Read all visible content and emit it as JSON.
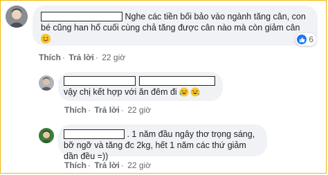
{
  "comments": [
    {
      "text": "Nghe các tiền bối bảo vào ngành tăng cân, con bé cũng han hố cuối cùng chả tăng được cân nào mà còn giảm cân",
      "emoji": "slightly-smiling-face",
      "reaction_count": "6",
      "actions": {
        "like": "Thích",
        "reply": "Trả lời",
        "time": "22 giờ"
      }
    },
    {
      "text": "vậy chị kết hợp với ăn đêm đi",
      "emoji": "rolling-on-floor-laughing",
      "actions": {
        "like": "Thích",
        "reply": "Trả lời",
        "time": "22 giờ"
      }
    },
    {
      "text": ". 1 năm đầu ngây thơ trọng sáng, bỡ ngỡ và tăng đc 2kg, hết 1 năm các thứ giảm dần đều =))",
      "actions": {
        "like": "Thích",
        "reply": "Trả lời",
        "time": "22 giờ"
      }
    }
  ],
  "colors": {
    "bubble": "#f0f2f5",
    "meta_text": "#65676b",
    "like_blue": "#1877f2",
    "frame": "#f2b705"
  }
}
